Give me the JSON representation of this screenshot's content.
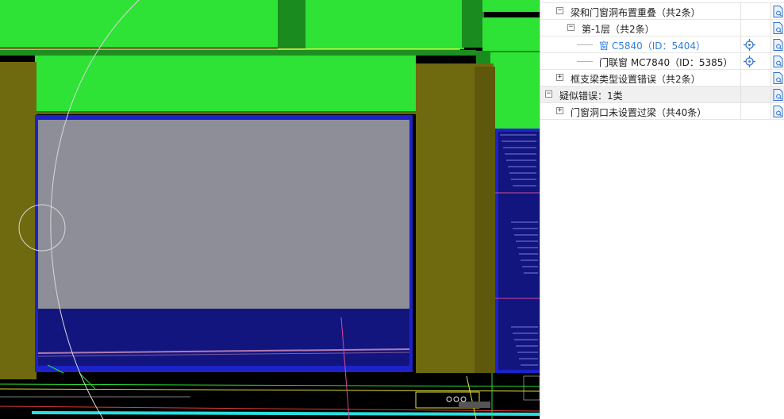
{
  "colors": {
    "beam_green": "#2fe236",
    "column_olive": "#6f6a0f",
    "window_blue": "#1d23c8",
    "glass_gray": "#8e8e98",
    "selected_text": "#2f7fe0",
    "panel_bg": "#ffffff",
    "category_bg": "#f0f0f0"
  },
  "tree": {
    "rows": [
      {
        "label": "梁和门窗洞布置重叠（共2条）",
        "indent": 1,
        "expander": "−",
        "kind": "group"
      },
      {
        "label": "第-1层（共2条）",
        "indent": 2,
        "expander": "−",
        "kind": "floor"
      },
      {
        "label": "窗 C5840（ID：5404）",
        "indent": 3,
        "expander": "",
        "kind": "item",
        "selected": true,
        "locate_icon": "locate-icon"
      },
      {
        "label": "门联窗 MC7840（ID：5385）",
        "indent": 3,
        "expander": "",
        "kind": "item",
        "selected": false,
        "locate_icon": "locate-icon"
      },
      {
        "label": "框支梁类型设置错误（共2条）",
        "indent": 1,
        "expander": "+",
        "kind": "group"
      },
      {
        "label": "疑似错误：1类",
        "indent": 0,
        "expander": "−",
        "kind": "category"
      },
      {
        "label": "门窗洞口未设置过梁（共40条）",
        "indent": 1,
        "expander": "+",
        "kind": "group"
      }
    ]
  }
}
